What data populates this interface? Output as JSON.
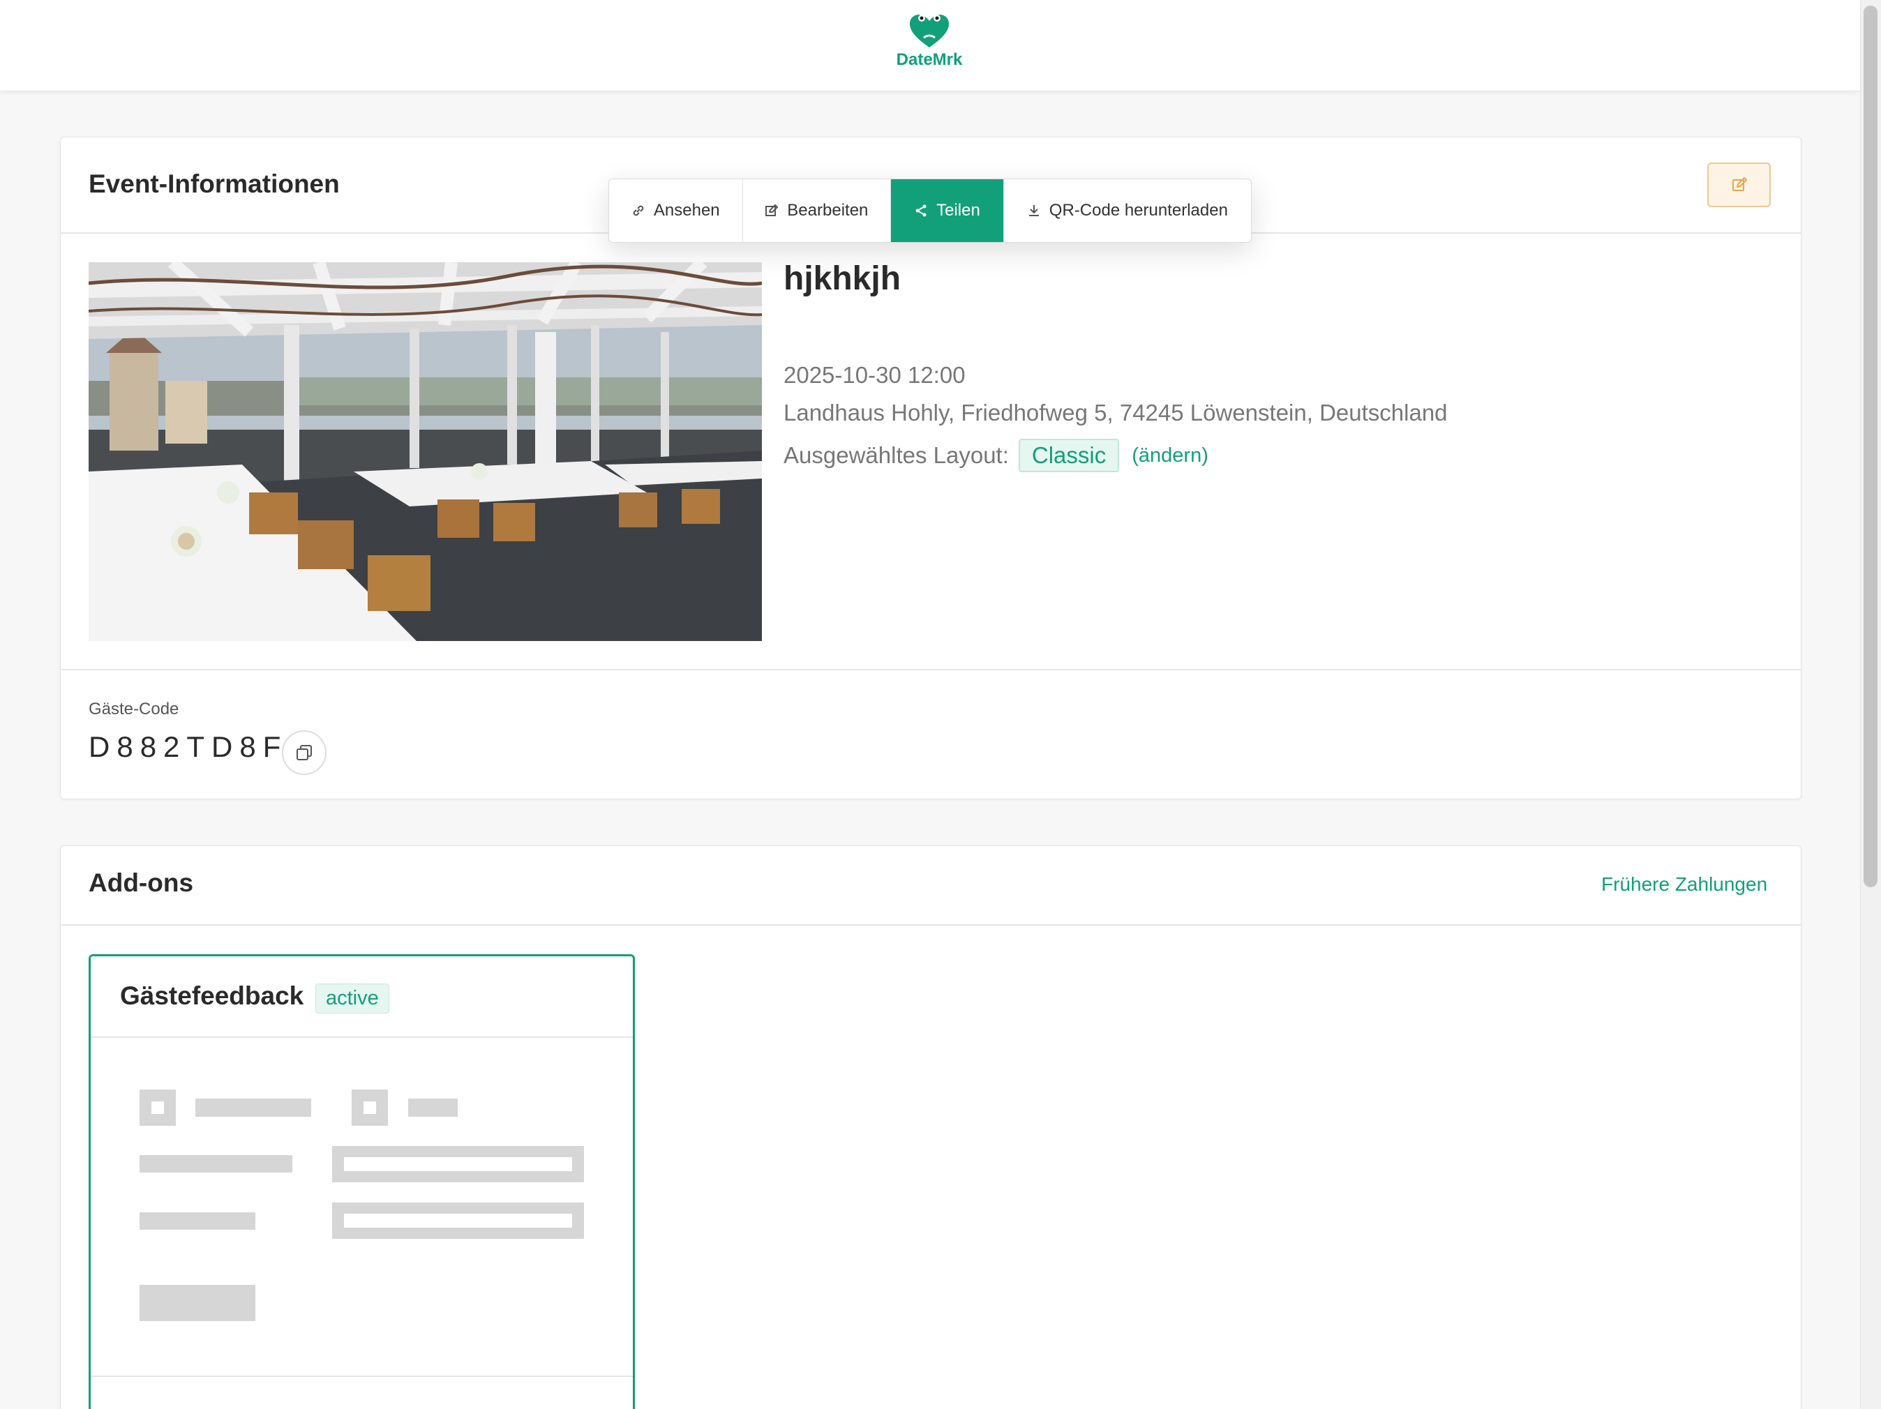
{
  "app": {
    "brand_name": "DateMrk",
    "brand_color": "#12a07a",
    "logo_icon": "frog-heart-icon"
  },
  "event_card": {
    "title": "Event-Informationen",
    "edit_icon": "edit-icon",
    "menu": [
      {
        "label": "Ansehen",
        "icon": "link-icon",
        "active": false
      },
      {
        "label": "Bearbeiten",
        "icon": "edit-icon",
        "active": false
      },
      {
        "label": "Teilen",
        "icon": "share-icon",
        "active": true
      },
      {
        "label": "QR-Code herunterladen",
        "icon": "download-icon",
        "active": false
      }
    ],
    "event_name": "hjkhkjh",
    "date": "2025-10-30 12:00",
    "address": "Landhaus Hohly, Friedhofweg 5, 74245 Löwenstein, Deutschland",
    "layout_label": "Ausgewähltes Layout:",
    "layout_value": "Classic",
    "layout_change": "(ändern)",
    "photo_alt": "venue-photo"
  },
  "guest": {
    "label": "Gäste-Code",
    "code": "D882TD8F",
    "copy_icon": "copy-icon"
  },
  "addons_card": {
    "title": "Add-ons",
    "previous_payments": "Frühere Zahlungen",
    "addon": {
      "title": "Gästefeedback",
      "status": "active"
    }
  }
}
